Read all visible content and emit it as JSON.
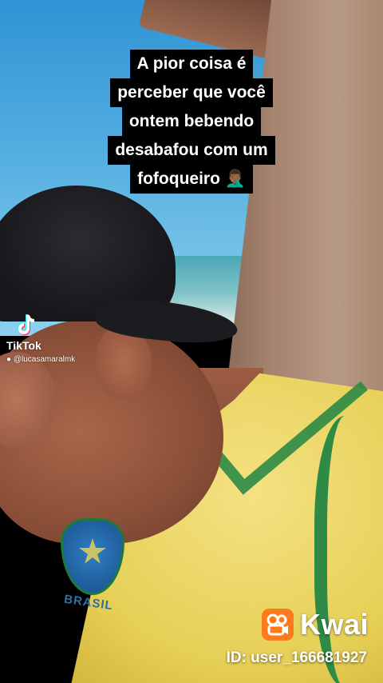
{
  "caption": {
    "lines": [
      "A pior coisa é",
      "perceber que você",
      "ontem bebendo",
      "desabafou com um",
      "fofoqueiro 🤦🏾‍♂️"
    ]
  },
  "tiktok_watermark": {
    "brand": "TikTok",
    "username": "@lucasamaralmk",
    "icon": "tiktok-logo-icon"
  },
  "kwai_watermark": {
    "brand": "Kwai",
    "user_id": "ID: user_166681927",
    "icon": "kwai-logo-icon",
    "accent": "#ff7a1a"
  },
  "jersey": {
    "text": "BRASIL",
    "colors": {
      "yellow": "#e6cf55",
      "green": "#2e8a45",
      "blue": "#2161a0"
    }
  }
}
